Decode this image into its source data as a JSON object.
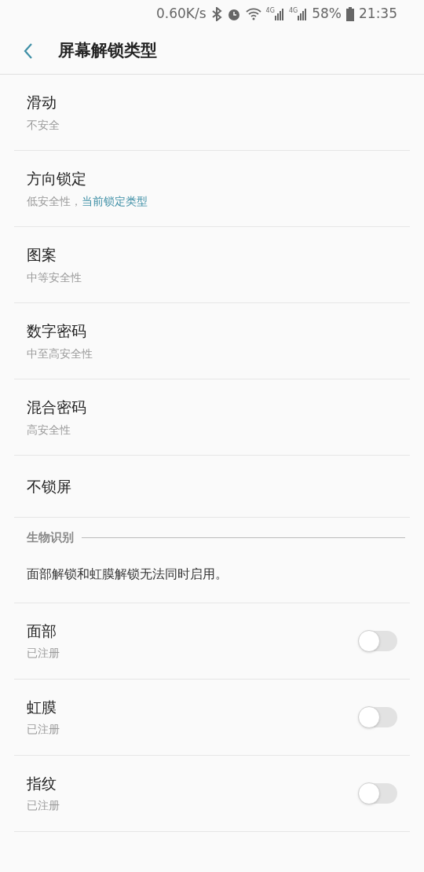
{
  "status_bar": {
    "speed": "0.60K/s",
    "network_1": "4G",
    "network_2": "4G",
    "battery": "58%",
    "time": "21:35"
  },
  "header": {
    "title": "屏幕解锁类型"
  },
  "lock_types": [
    {
      "title": "滑动",
      "subtitle": "不安全"
    },
    {
      "title": "方向锁定",
      "subtitle": "低安全性，",
      "current_note": "当前锁定类型"
    },
    {
      "title": "图案",
      "subtitle": "中等安全性"
    },
    {
      "title": "数字密码",
      "subtitle": "中至高安全性"
    },
    {
      "title": "混合密码",
      "subtitle": "高安全性"
    },
    {
      "title": "不锁屏"
    }
  ],
  "biometrics": {
    "section_title": "生物识别",
    "note": "面部解锁和虹膜解锁无法同时启用。",
    "items": [
      {
        "title": "面部",
        "subtitle": "已注册",
        "on": false
      },
      {
        "title": "虹膜",
        "subtitle": "已注册",
        "on": false
      },
      {
        "title": "指纹",
        "subtitle": "已注册",
        "on": false
      }
    ]
  }
}
